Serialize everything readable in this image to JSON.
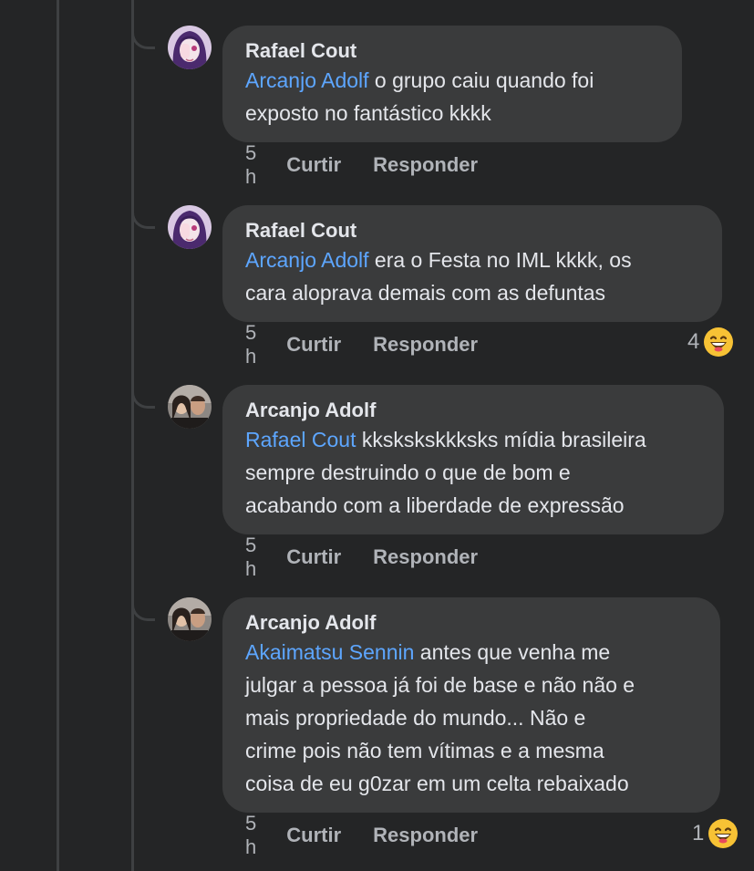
{
  "comments": [
    {
      "author": "Rafael Cout",
      "mention": "Arcanjo Adolf",
      "text_line1": " o grupo caiu quando foi",
      "text_lines": [
        "exposto no fantástico kkkk"
      ],
      "time": "5 h",
      "like_label": "Curtir",
      "reply_label": "Responder",
      "reaction_count": null
    },
    {
      "author": "Rafael Cout",
      "mention": "Arcanjo Adolf",
      "text_line1": " era o Festa no IML kkkk, os",
      "text_lines": [
        "cara aloprava demais com as defuntas"
      ],
      "time": "5 h",
      "like_label": "Curtir",
      "reply_label": "Responder",
      "reaction_count": "4"
    },
    {
      "author": "Arcanjo Adolf",
      "mention": "Rafael Cout",
      "text_line1": " kksksksk­kksks mídia brasileira",
      "text_lines": [
        "sempre destruindo o que de bom e",
        "acabando com a liberdade de expressão"
      ],
      "time": "5 h",
      "like_label": "Curtir",
      "reply_label": "Responder",
      "reaction_count": null
    },
    {
      "author": "Arcanjo Adolf",
      "mention": "Akaimatsu Sennin",
      "text_line1": " antes que venha me",
      "text_lines": [
        "julgar a pessoa já foi de base e não não e",
        "mais propriedade do mundo... Não e",
        "crime pois não tem vítimas e a mesma",
        "coisa de eu g0zar em um celta rebaixado"
      ],
      "time": "5 h",
      "like_label": "Curtir",
      "reply_label": "Responder",
      "reaction_count": "1"
    }
  ],
  "icons": {
    "reaction": "laughing-emoji-icon"
  },
  "colors": {
    "background": "#242526",
    "bubble": "#3a3b3c",
    "mention": "#5da6ff",
    "secondary_text": "#b0b3b8",
    "thread_line": "#3e4042"
  }
}
